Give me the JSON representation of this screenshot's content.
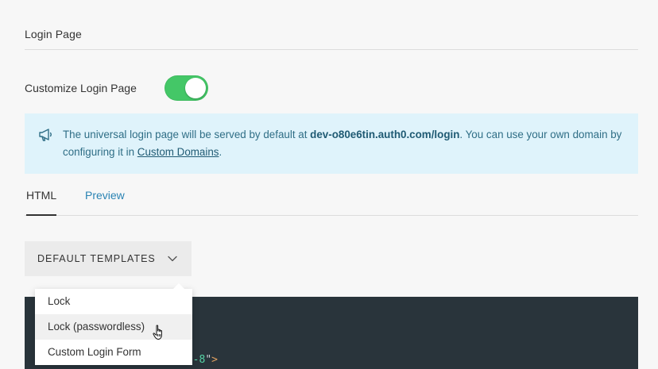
{
  "section": {
    "title": "Login Page"
  },
  "customize": {
    "label": "Customize Login Page",
    "enabled": true
  },
  "info": {
    "prefix": "The universal login page will be served by default at ",
    "domain": "dev-o80e6tin.auth0.com/login",
    "middle": ". You can use your own domain by configuring it in ",
    "link": "Custom Domains",
    "suffix": "."
  },
  "tabs": {
    "html": "HTML",
    "preview": "Preview",
    "active": "HTML"
  },
  "templates": {
    "button_label": "DEFAULT TEMPLATES",
    "options": [
      "Lock",
      "Lock (passwordless)",
      "Custom Login Form"
    ],
    "hovered": "Lock (passwordless)"
  },
  "editor": {
    "visible_code_attr": "tf-8",
    "visible_code_quote": "\"",
    "visible_code_close": ">"
  },
  "colors": {
    "toggle_on": "#44c767",
    "info_bg": "#dff3fb",
    "link": "#2a83b3",
    "editor_bg": "#29343b"
  }
}
